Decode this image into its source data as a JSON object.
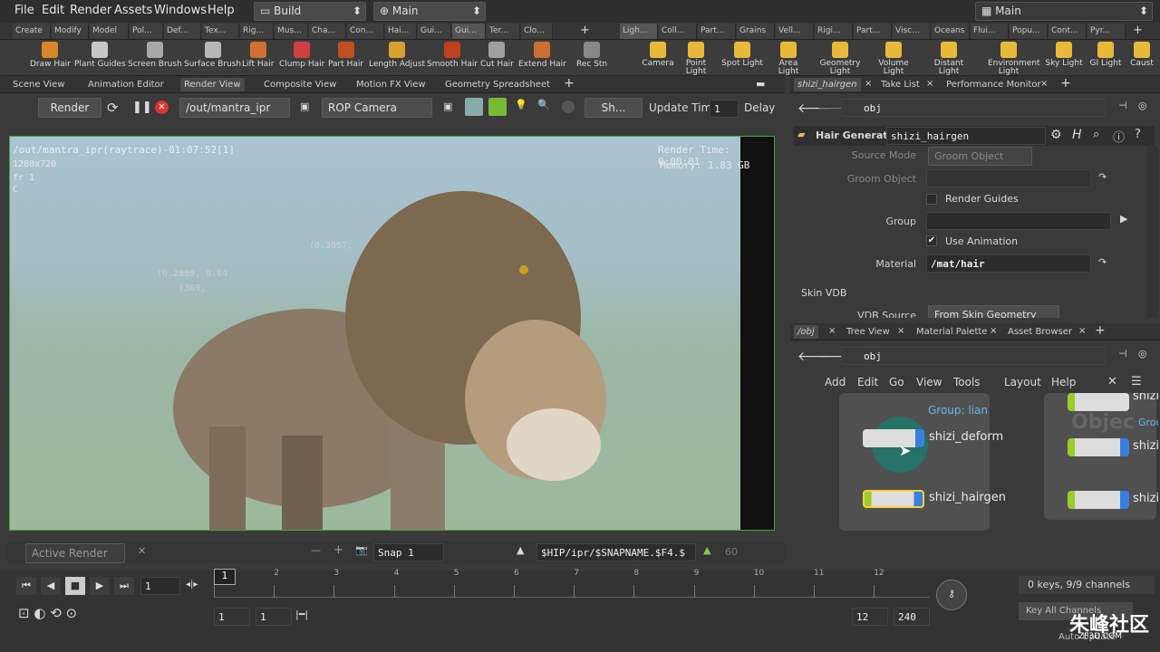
{
  "menu": [
    "File",
    "Edit",
    "Render",
    "Assets",
    "Windows",
    "Help"
  ],
  "desktop": "Build",
  "desktop2": "Main",
  "desktop3": "Main",
  "shelf_tabs_left": [
    "Create",
    "Modify",
    "Model",
    "Pol...",
    "Def...",
    "Tex...",
    "Rig...",
    "Mus...",
    "Cha...",
    "Con...",
    "Hai...",
    "Gui...",
    "Gui...",
    "Ter...",
    "Clo..."
  ],
  "shelf_tabs_right": [
    "Ligh...",
    "Coll...",
    "Part...",
    "Grains",
    "Vell...",
    "Rigi...",
    "Part...",
    "Visc...",
    "Oceans",
    "Flui...",
    "Popu...",
    "Cont...",
    "Pyr..."
  ],
  "tools_left": [
    "Draw Hair",
    "Plant Guides",
    "Screen Brush",
    "Surface Brush",
    "Lift Hair",
    "Clump Hair",
    "Part Hair",
    "Length Adjust",
    "Smooth Hair",
    "Cut Hair",
    "Extend Hair",
    "Rec Stn"
  ],
  "tools_right": [
    "Camera",
    "Point Light",
    "Spot Light",
    "Area Light",
    "Geometry Light",
    "Volume Light",
    "Distant Light",
    "Environment Light",
    "Sky Light",
    "GI Light",
    "Caust"
  ],
  "pane_tabs": [
    "Scene View",
    "Animation Editor",
    "Render View",
    "Composite View",
    "Motion FX View",
    "Geometry Spreadsheet"
  ],
  "render": {
    "btn": "Render",
    "driver": "/out/mantra_ipr",
    "camera": "ROP Camera",
    "sh": "Sh...",
    "update": "Update Time",
    "update_val": "1",
    "delay": "Delay"
  },
  "overlay": {
    "title": "/out/mantra_ipr(raytrace)-01:07:52[1]",
    "res": "1280x720",
    "fr": "fr 1",
    "c": "C",
    "rtime": "Render Time: 0:00:01",
    "mem": "Memory:      1.83 GB",
    "c1": "(0.3957,",
    "c2": "(0.2889, 0.64",
    "c3": "(369,"
  },
  "render_bottom": {
    "active": "Active Render",
    "snap": "Snap 1",
    "path": "$HIP/ipr/$SNAPNAME.$F4.$",
    "num": "60"
  },
  "param_tabs": [
    "shizi_hairgen",
    "Take List",
    "Performance Monitor"
  ],
  "params": {
    "path": "obj",
    "node_type": "Hair Generate",
    "node_name": "shizi_hairgen",
    "source_mode_l": "Source Mode",
    "source_mode": "Groom Object",
    "groom_l": "Groom Object",
    "render_guides": "Render Guides",
    "group_l": "Group",
    "use_anim": "Use Animation",
    "material_l": "Material",
    "material": "/mat/hair",
    "skin": "Skin VDB",
    "vdb_l": "VDB Source",
    "vdb": "From Skin Geometry"
  },
  "net_tabs": [
    "/obj",
    "Tree View",
    "Material Palette",
    "Asset Browser"
  ],
  "net": {
    "path": "obj",
    "menu": [
      "Add",
      "Edit",
      "Go",
      "View",
      "Tools",
      "Layout",
      "Help"
    ],
    "group": "Group: lian",
    "node1": "shizi_deform",
    "node2": "shizi_hairgen",
    "r1": "shizi",
    "r2": "shizi",
    "r3": "shizi",
    "objtext": "Objec",
    "grou": "Grou"
  },
  "timeline": {
    "ticks": [
      "1",
      "2",
      "3",
      "4",
      "5",
      "6",
      "7",
      "8",
      "9",
      "10",
      "11",
      "12"
    ],
    "frame": "1",
    "start": "1",
    "start2": "1",
    "end": "12",
    "end2": "240",
    "keys": "0 keys, 9/9 channels",
    "keyall": "Key All Channels",
    "autoupd": "Auto Update"
  },
  "watermark": "朱峰社区",
  "watermark2": "ZF3D.COM"
}
